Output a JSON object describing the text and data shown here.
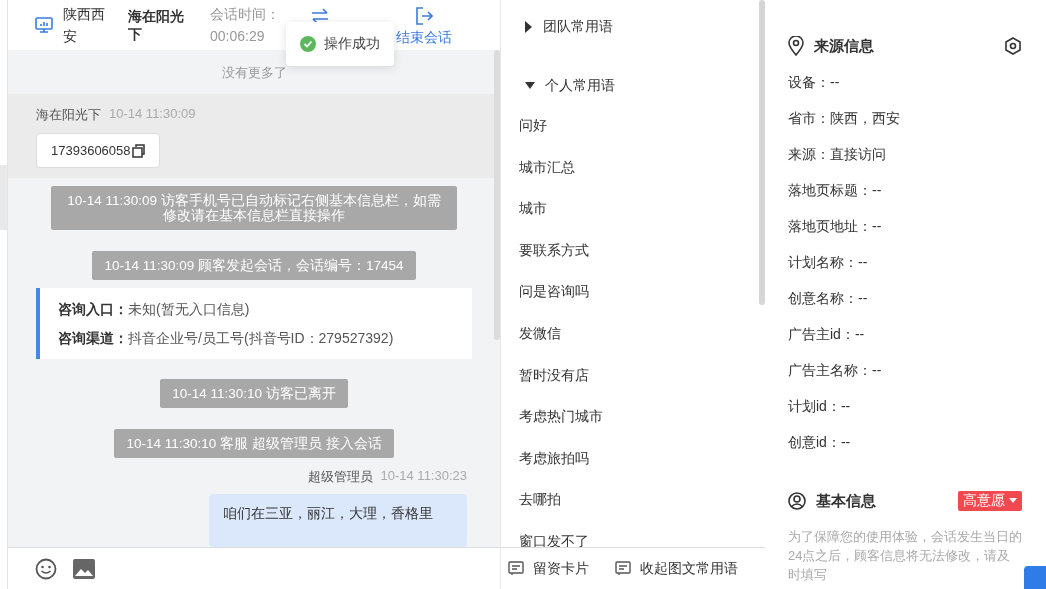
{
  "header": {
    "location": "陕西西安",
    "visitor": "海在阳光下",
    "duration_label": "会话时间：",
    "duration": "00:06:29",
    "end_button": "结束会话"
  },
  "toast": {
    "text": "操作成功"
  },
  "chat": {
    "no_more": "没有更多了",
    "messages": [
      {
        "kind": "visitor",
        "sender": "海在阳光下",
        "time": "10-14 11:30:09",
        "text": "17393606058"
      },
      {
        "kind": "system",
        "text": "10-14 11:30:09 访客手机号已自动标记右侧基本信息栏，如需修改请在基本信息栏直接操作"
      },
      {
        "kind": "system",
        "text": "10-14 11:30:09 顾客发起会话，会话编号：17454"
      },
      {
        "kind": "entry",
        "fields": [
          {
            "label": "咨询入口：",
            "value": "未知(暂无入口信息)"
          },
          {
            "label": "咨询渠道：",
            "value": "抖音企业号/员工号(抖音号ID：279527392)"
          }
        ]
      },
      {
        "kind": "system",
        "text": "10-14 11:30:10 访客已离开"
      },
      {
        "kind": "system",
        "text": "10-14 11:30:10 客服 超级管理员 接入会话"
      },
      {
        "kind": "agent",
        "sender": "超级管理员",
        "time": "10-14 11:30:23",
        "text": "咱们在三亚，丽江，大理，香格里"
      }
    ]
  },
  "phrases": {
    "groups": [
      {
        "label": "团队常用语",
        "expanded": false
      },
      {
        "label": "个人常用语",
        "expanded": true,
        "items": [
          "问好",
          "城市汇总",
          "城市",
          "要联系方式",
          "问是咨询吗",
          "发微信",
          "暂时没有店",
          "考虑热门城市",
          "考虑旅拍吗",
          "去哪拍",
          "窗口发不了"
        ]
      }
    ],
    "footer": [
      "留资卡片",
      "收起图文常用语"
    ]
  },
  "source_info": {
    "title": "来源信息",
    "fields": [
      "设备：--",
      "省市：陕西，西安",
      "来源：直接访问",
      "落地页标题：--",
      "落地页地址：--",
      "计划名称：--",
      "创意名称：--",
      "广告主id：--",
      "广告主名称：--",
      "计划id：--",
      "创意id：--"
    ]
  },
  "basic_info": {
    "title": "基本信息",
    "intent": "高意愿",
    "notice": "为了保障您的使用体验，会话发生当日的24点之后，顾客信息将无法修改，请及时填写"
  }
}
